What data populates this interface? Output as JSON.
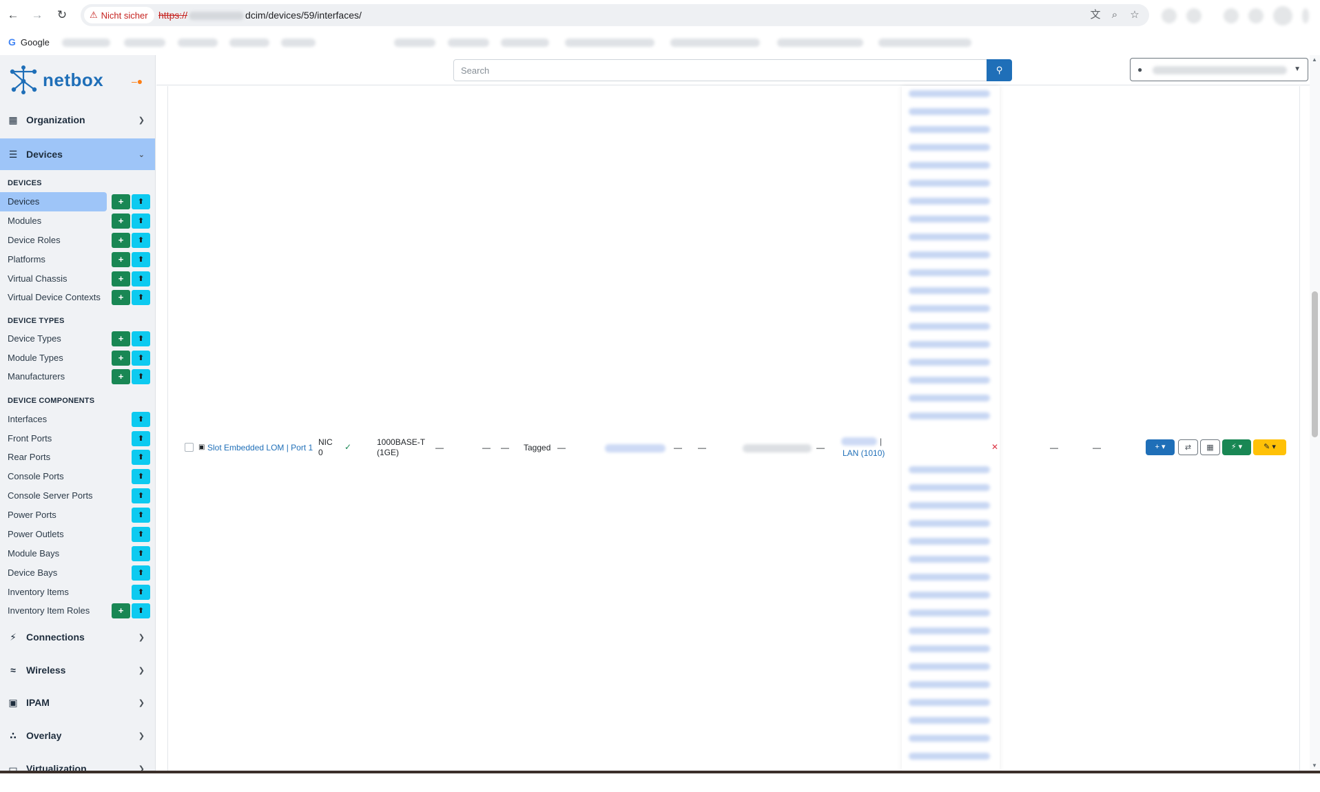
{
  "browser": {
    "security_label": "Nicht sicher",
    "url_scheme": "https://",
    "url_path": "dcim/devices/59/interfaces/",
    "bookmark_google": "Google"
  },
  "brand": {
    "name": "netbox"
  },
  "search": {
    "placeholder": "Search"
  },
  "sidebar": {
    "groups": {
      "organization": "Organization",
      "devices": "Devices",
      "connections": "Connections",
      "wireless": "Wireless",
      "ipam": "IPAM",
      "overlay": "Overlay",
      "virtualization": "Virtualization"
    },
    "sections": {
      "devices": "DEVICES",
      "device_types": "DEVICE TYPES",
      "device_components": "DEVICE COMPONENTS"
    },
    "items": {
      "devices": "Devices",
      "modules": "Modules",
      "device_roles": "Device Roles",
      "platforms": "Platforms",
      "virtual_chassis": "Virtual Chassis",
      "virtual_device_contexts": "Virtual Device Contexts",
      "device_types": "Device Types",
      "module_types": "Module Types",
      "manufacturers": "Manufacturers",
      "interfaces": "Interfaces",
      "front_ports": "Front Ports",
      "rear_ports": "Rear Ports",
      "console_ports": "Console Ports",
      "console_server_ports": "Console Server Ports",
      "power_ports": "Power Ports",
      "power_outlets": "Power Outlets",
      "module_bays": "Module Bays",
      "device_bays": "Device Bays",
      "inventory_items": "Inventory Items",
      "inventory_item_roles": "Inventory Item Roles"
    }
  },
  "row": {
    "name": "Slot Embedded LOM | Port 1",
    "label_line1": "NIC",
    "label_line2": "0",
    "type_line1": "1000BASE-T",
    "type_line2": "(1GE)",
    "dash": "—",
    "mode": "Tagged",
    "vlan_sep": "|",
    "vlan": "LAN (1010)"
  },
  "colors": {
    "primary": "#1f6fb8",
    "success": "#198754",
    "info": "#0dcaf0",
    "warning": "#ffc107",
    "danger": "#dc3545",
    "sidebar_active": "#9ec5f8"
  }
}
